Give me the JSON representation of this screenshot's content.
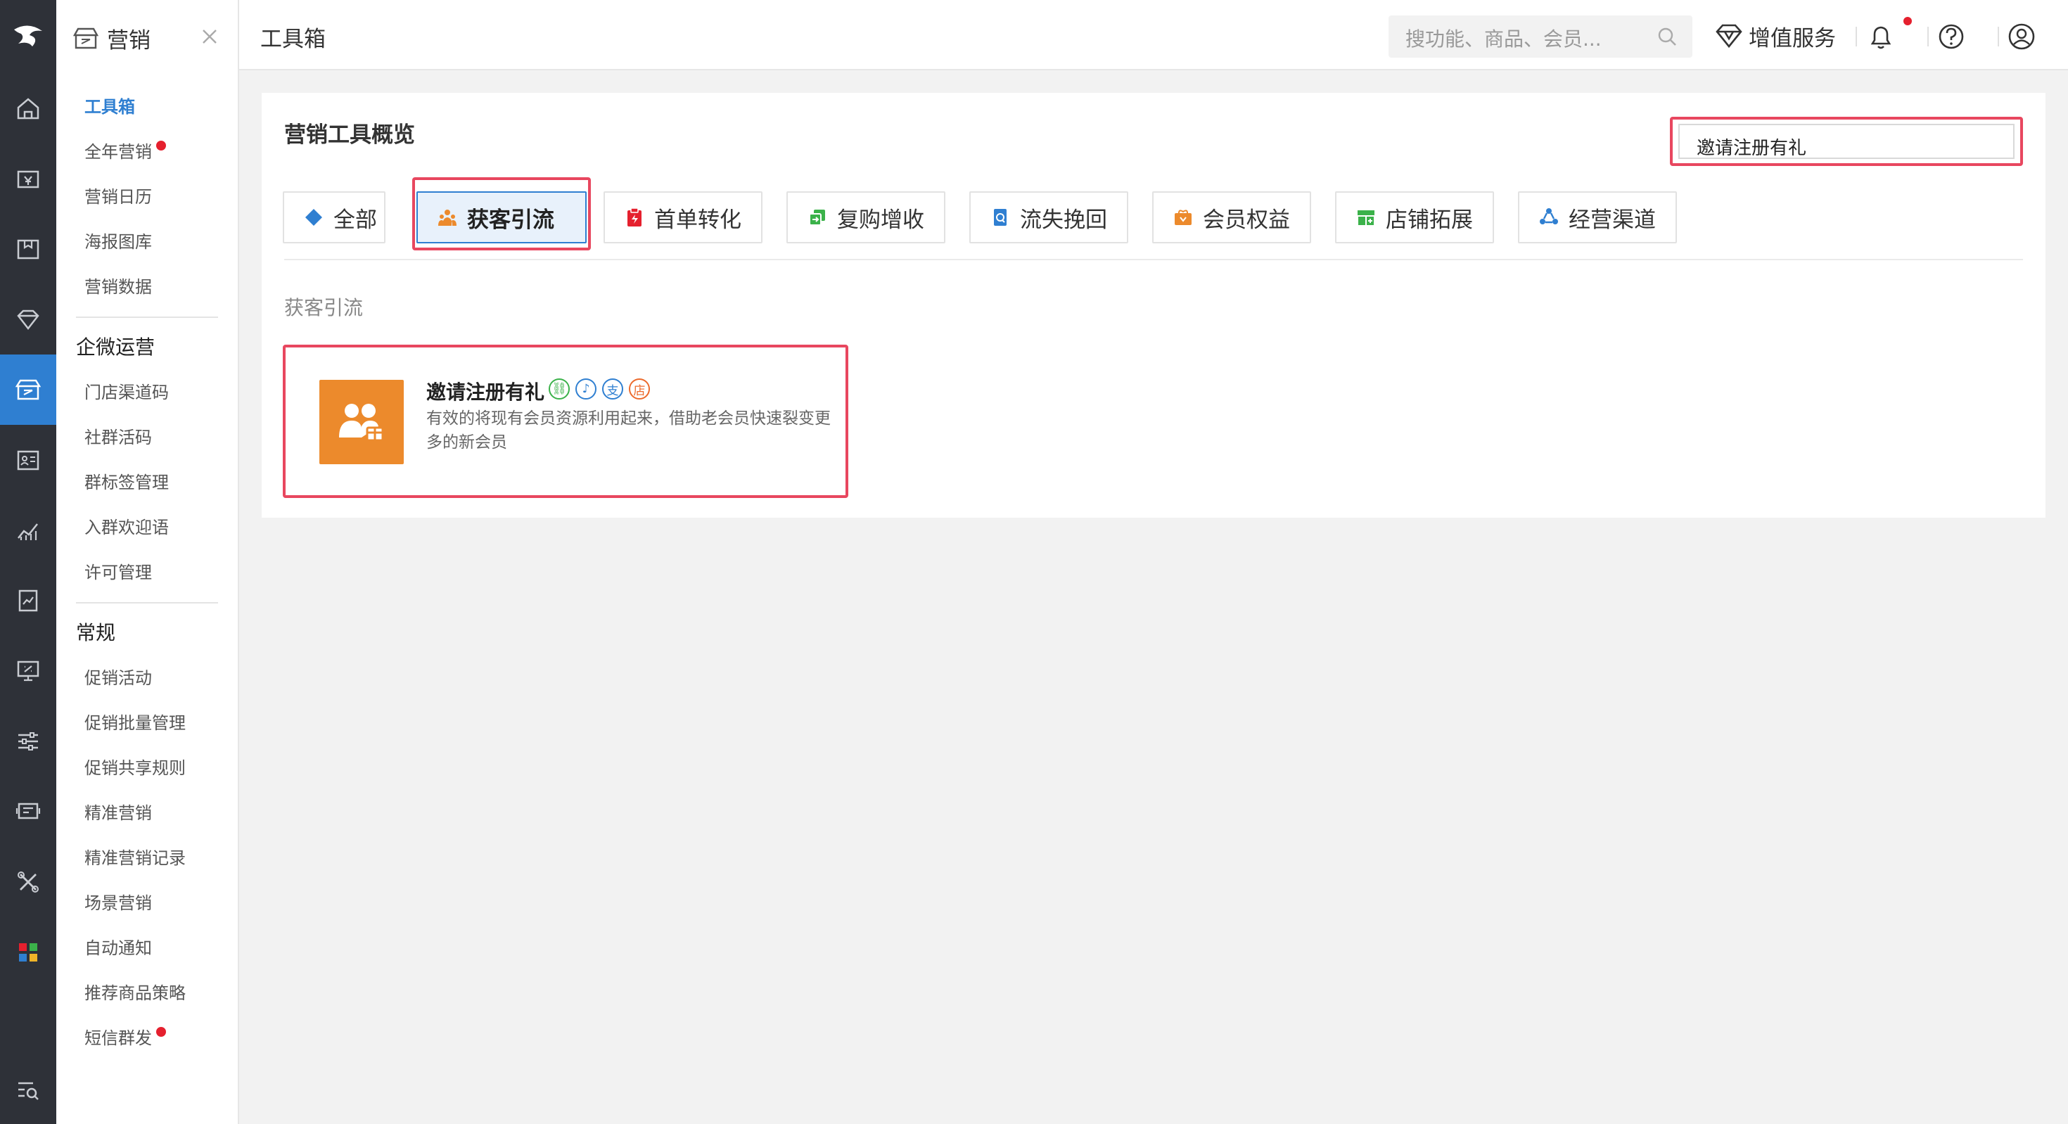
{
  "app": {
    "module_title": "营销",
    "breadcrumb": "工具箱"
  },
  "sidebar": {
    "items_top": [
      {
        "label": "工具箱",
        "active": true
      },
      {
        "label": "全年营销",
        "dot": true
      },
      {
        "label": "营销日历"
      },
      {
        "label": "海报图库"
      },
      {
        "label": "营销数据"
      }
    ],
    "group_wechat": "企微运营",
    "items_wechat": [
      {
        "label": "门店渠道码"
      },
      {
        "label": "社群活码"
      },
      {
        "label": "群标签管理"
      },
      {
        "label": "入群欢迎语"
      },
      {
        "label": "许可管理"
      }
    ],
    "group_regular": "常规",
    "items_regular": [
      {
        "label": "促销活动"
      },
      {
        "label": "促销批量管理"
      },
      {
        "label": "促销共享规则"
      },
      {
        "label": "精准营销"
      },
      {
        "label": "精准营销记录"
      },
      {
        "label": "场景营销"
      },
      {
        "label": "自动通知"
      },
      {
        "label": "推荐商品策略"
      },
      {
        "label": "短信群发",
        "dot": true
      }
    ]
  },
  "topbar": {
    "search_placeholder": "搜功能、商品、会员...",
    "value_added": "增值服务"
  },
  "main": {
    "title": "营销工具概览",
    "tool_search_value": "邀请注册有礼",
    "tabs": [
      {
        "label": "全部",
        "icon": "diamond-grid-icon",
        "color": "#2f7fd1"
      },
      {
        "label": "获客引流",
        "icon": "people-icon",
        "color": "#ec8a2c",
        "active": true
      },
      {
        "label": "首单转化",
        "icon": "clipboard-icon",
        "color": "#e5202e"
      },
      {
        "label": "复购增收",
        "icon": "repeat-icon",
        "color": "#3bb24a"
      },
      {
        "label": "流失挽回",
        "icon": "recover-icon",
        "color": "#2f7fd1"
      },
      {
        "label": "会员权益",
        "icon": "gift-box-icon",
        "color": "#ec8a2c"
      },
      {
        "label": "店铺拓展",
        "icon": "store-icon",
        "color": "#3bb24a"
      },
      {
        "label": "经营渠道",
        "icon": "channel-icon",
        "color": "#2f7fd1"
      }
    ],
    "section_label": "获客引流",
    "tool": {
      "name": "邀请注册有礼",
      "description": "有效的将现有会员资源利用起来，借助老会员快速裂变更多的新会员",
      "badges": [
        {
          "glyph": "⛓",
          "color": "#3bb24a",
          "icon": "link-icon"
        },
        {
          "glyph": "♪",
          "color": "#2f7fd1",
          "icon": "douyin-icon"
        },
        {
          "glyph": "支",
          "color": "#2f7fd1",
          "icon": "alipay-icon"
        },
        {
          "glyph": "店",
          "color": "#ec6a2c",
          "icon": "store-badge-icon"
        }
      ]
    }
  },
  "colors": {
    "accent": "#2f7fd1",
    "highlight": "#e8475f",
    "rail": "#2e3138",
    "tool_orange": "#ec8a2c"
  }
}
